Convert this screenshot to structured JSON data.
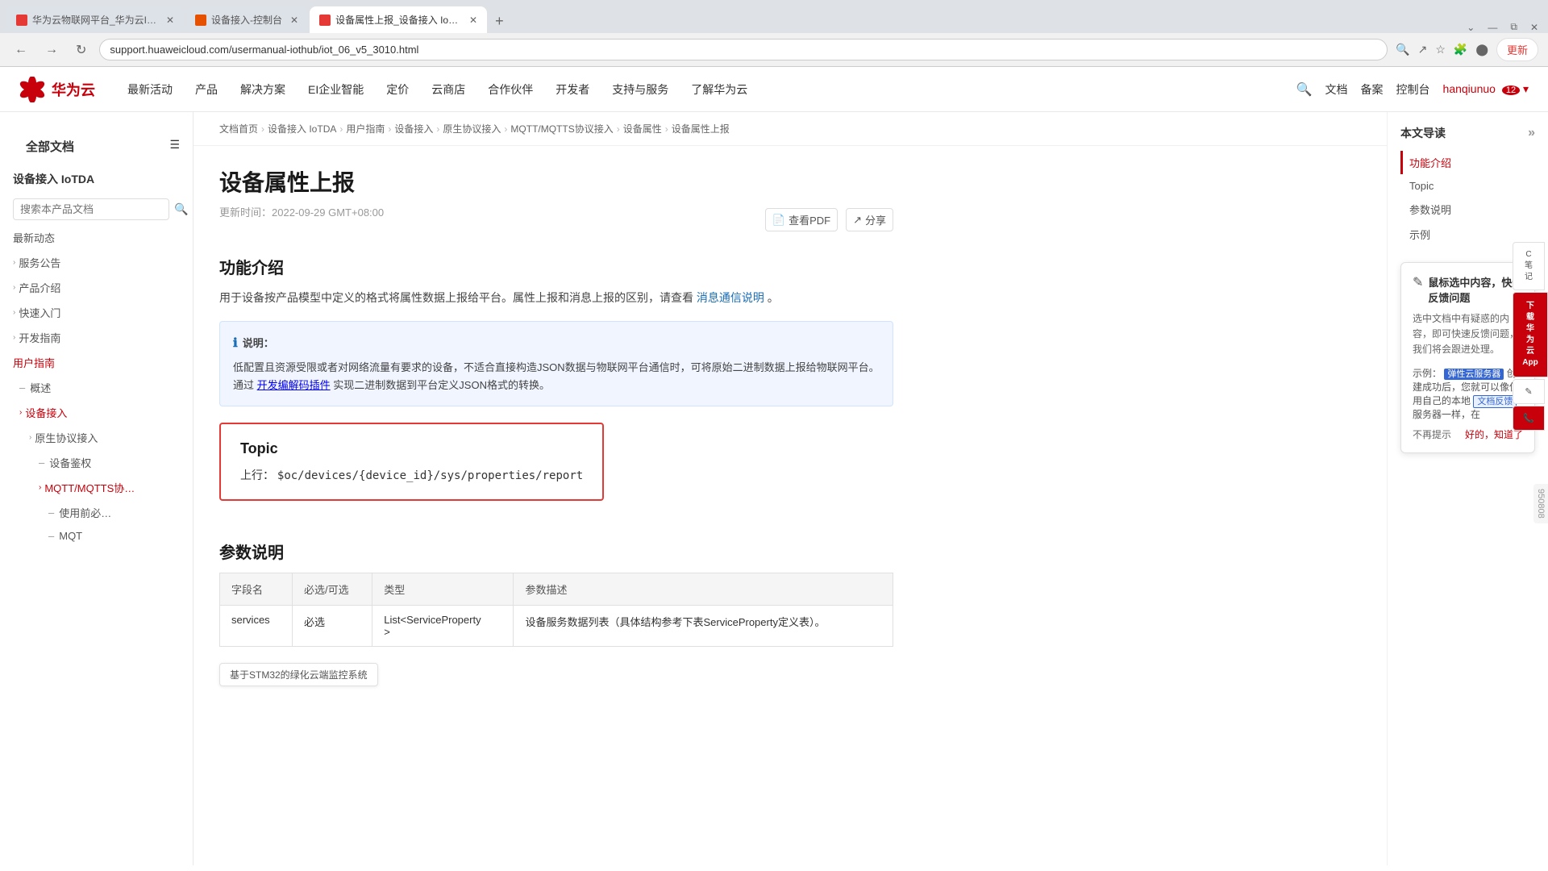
{
  "browser": {
    "tabs": [
      {
        "label": "华为云物联网平台_华为云IoT平…",
        "active": false,
        "favicon": "red"
      },
      {
        "label": "设备接入-控制台",
        "active": false,
        "favicon": "orange"
      },
      {
        "label": "设备属性上报_设备接入 IoTDA_…",
        "active": true,
        "favicon": "red"
      }
    ],
    "address": "support.huaweicloud.com/usermanual-iothub/iot_06_v5_3010.html",
    "update_btn": "更新"
  },
  "topnav": {
    "logo_text": "华为云",
    "items": [
      "最新活动",
      "产品",
      "解决方案",
      "EI企业智能",
      "定价",
      "云商店",
      "合作伙伴",
      "开发者",
      "支持与服务",
      "了解华为云"
    ],
    "right_items": [
      "文档",
      "备案",
      "控制台"
    ],
    "user": "hanqiunuo",
    "user_badge": "12"
  },
  "sidebar": {
    "all_docs": "全部文档",
    "product": "设备接入 IoTDA",
    "search_placeholder": "搜索本产品文档",
    "items": [
      {
        "label": "最新动态",
        "level": 0
      },
      {
        "label": "服务公告",
        "level": 0,
        "arrow": "›"
      },
      {
        "label": "产品介绍",
        "level": 0,
        "arrow": "›"
      },
      {
        "label": "快速入门",
        "level": 0,
        "arrow": "›"
      },
      {
        "label": "开发指南",
        "level": 0,
        "arrow": "›"
      },
      {
        "label": "用户指南",
        "level": 0,
        "active": true
      },
      {
        "label": "概述",
        "level": 1,
        "prefix": "–"
      },
      {
        "label": "设备接入",
        "level": 1,
        "arrow": "›",
        "active": true
      },
      {
        "label": "原生协议接入",
        "level": 2,
        "arrow": "›",
        "active": true
      },
      {
        "label": "设备鉴权",
        "level": 3,
        "prefix": "–"
      },
      {
        "label": "MQTT/MQTTS协…",
        "level": 3,
        "arrow": "›",
        "active": true
      },
      {
        "label": "使用前必…",
        "level": 4,
        "prefix": "–"
      },
      {
        "label": "MQT",
        "level": 4,
        "prefix": "–"
      }
    ]
  },
  "breadcrumb": {
    "items": [
      "文档首页",
      "设备接入 IoTDA",
      "用户指南",
      "设备接入",
      "原生协议接入",
      "MQTT/MQTTS协议接入",
      "设备属性",
      "设备属性上报"
    ]
  },
  "article": {
    "title": "设备属性上报",
    "updated": "更新时间：2022-09-29 GMT+08:00",
    "pdf_label": "查看PDF",
    "share_label": "分享",
    "sections": {
      "intro_title": "功能介绍",
      "intro_desc": "用于设备按产品模型中定义的格式将属性数据上报给平台。属性上报和消息上报的区别，请查看",
      "intro_link": "消息通信说明",
      "intro_desc2": "。",
      "info_title": "说明：",
      "info_text": "低配置且资源受限或者对网络流量有要求的设备，不适合直接构造JSON数据与物联网平台通信时，可将原始二进制数据上报给物联网平台。通过",
      "info_link": "开发编解码插件",
      "info_text2": "实现二进制数据到平台定义JSON格式的转换。",
      "topic_title": "Topic",
      "topic_upstream_label": "上行：",
      "topic_upstream_value": "$oc/devices/{device_id}/sys/properties/report",
      "params_title": "参数说明",
      "table": {
        "headers": [
          "字段名",
          "必选/可选",
          "类型",
          "参数描述"
        ],
        "rows": [
          [
            "services",
            "必选",
            "List<ServiceProperty\n>",
            "设备服务数据列表（具体结构参考下表ServiceProperty定义表）。"
          ]
        ]
      }
    }
  },
  "toc": {
    "title": "本文导读",
    "items": [
      {
        "label": "功能介绍",
        "active": true
      },
      {
        "label": "Topic",
        "active": false
      },
      {
        "label": "参数说明",
        "active": false
      },
      {
        "label": "示例",
        "active": false
      }
    ]
  },
  "feedback": {
    "title": "鼠标选中内容，快速反馈问题",
    "desc": "选中文档中有疑惑的内容，即可快速反馈问题，我们将会跟进处理。",
    "example_label": "示例：",
    "highlight1": "弹性云服务器",
    "example_text1": "创建成功后，您就可以像使用自己的本地",
    "highlight2": "文档反馈",
    "example_text2": "服务器一样，在",
    "no_remind": "不再提示",
    "confirm": "好的，知道了"
  },
  "right_btns": [
    {
      "label": "C\n笔\n记",
      "type": "note"
    },
    {
      "label": "下\n载\n华\n为\n云\nApp",
      "type": "download"
    },
    {
      "label": "✉",
      "type": "email"
    },
    {
      "label": "📞",
      "type": "phone"
    }
  ],
  "side_number": "950808",
  "popup": {
    "text": "基于STM32的绿化云端监控系统"
  }
}
